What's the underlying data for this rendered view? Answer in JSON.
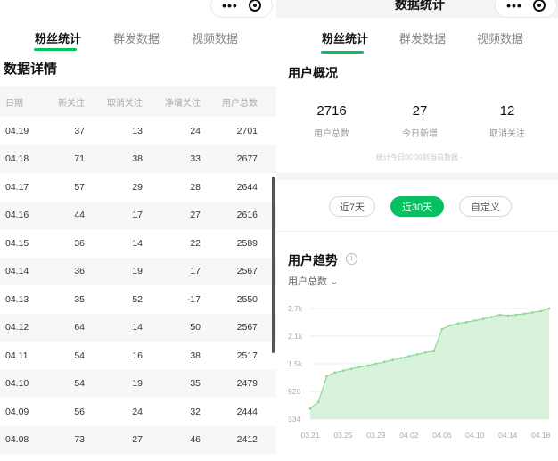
{
  "left": {
    "tabs": [
      {
        "label": "粉丝统计",
        "active": true
      },
      {
        "label": "群发数据",
        "active": false
      },
      {
        "label": "视频数据",
        "active": false
      }
    ],
    "capsule": {
      "more_icon": "more-dots-icon",
      "close_icon": "target-circle-icon"
    },
    "section_title": "数据详情",
    "columns": [
      "日期",
      "新关注",
      "取消关注",
      "净增关注",
      "用户总数"
    ],
    "rows": [
      [
        "04.19",
        "37",
        "13",
        "24",
        "2701"
      ],
      [
        "04.18",
        "71",
        "38",
        "33",
        "2677"
      ],
      [
        "04.17",
        "57",
        "29",
        "28",
        "2644"
      ],
      [
        "04.16",
        "44",
        "17",
        "27",
        "2616"
      ],
      [
        "04.15",
        "36",
        "14",
        "22",
        "2589"
      ],
      [
        "04.14",
        "36",
        "19",
        "17",
        "2567"
      ],
      [
        "04.13",
        "35",
        "52",
        "-17",
        "2550"
      ],
      [
        "04.12",
        "64",
        "14",
        "50",
        "2567"
      ],
      [
        "04.11",
        "54",
        "16",
        "38",
        "2517"
      ],
      [
        "04.10",
        "54",
        "19",
        "35",
        "2479"
      ],
      [
        "04.09",
        "56",
        "24",
        "32",
        "2444"
      ],
      [
        "04.08",
        "73",
        "27",
        "46",
        "2412"
      ]
    ]
  },
  "right": {
    "nav_title": "数据统计",
    "tabs": [
      {
        "label": "粉丝统计",
        "active": true
      },
      {
        "label": "群发数据",
        "active": false
      },
      {
        "label": "视频数据",
        "active": false
      }
    ],
    "overview": {
      "title": "用户概况",
      "stats": [
        {
          "value": "2716",
          "label": "用户总数"
        },
        {
          "value": "27",
          "label": "今日新增"
        },
        {
          "value": "12",
          "label": "取消关注"
        }
      ],
      "note": "· 统计今日00:00到当前数据 ·"
    },
    "range_buttons": [
      {
        "label": "近7天",
        "active": false
      },
      {
        "label": "近30天",
        "active": true
      },
      {
        "label": "自定义",
        "active": false
      }
    ],
    "trend_title": "用户趋势",
    "info_icon": "info-circle-icon",
    "metric_select": "用户总数",
    "accent": "#07c160",
    "area_fill": "#d9f2dc",
    "area_line": "#8fd99b"
  },
  "chart_data": {
    "type": "area",
    "title": "",
    "xlabel": "",
    "ylabel": "",
    "y_ticks": [
      "334",
      "926",
      "1.5k",
      "2.1k",
      "2.7k"
    ],
    "x_ticks": [
      "03.21",
      "03.25",
      "03.29",
      "04.02",
      "04.06",
      "04.10",
      "04.14",
      "04.18"
    ],
    "x": [
      "03.21",
      "03.22",
      "03.23",
      "03.24",
      "03.25",
      "03.26",
      "03.27",
      "03.28",
      "03.29",
      "03.30",
      "03.31",
      "04.01",
      "04.02",
      "04.03",
      "04.04",
      "04.05",
      "04.06",
      "04.07",
      "04.08",
      "04.09",
      "04.10",
      "04.11",
      "04.12",
      "04.13",
      "04.14",
      "04.15",
      "04.16",
      "04.17",
      "04.18",
      "04.19"
    ],
    "values": [
      560,
      700,
      1250,
      1330,
      1370,
      1410,
      1450,
      1480,
      1520,
      1560,
      1600,
      1640,
      1680,
      1720,
      1760,
      1790,
      2260,
      2340,
      2380,
      2410,
      2444,
      2479,
      2517,
      2567,
      2550,
      2567,
      2589,
      2616,
      2644,
      2701
    ],
    "ylim": [
      334,
      2701
    ],
    "grid": true,
    "legend": "none"
  }
}
